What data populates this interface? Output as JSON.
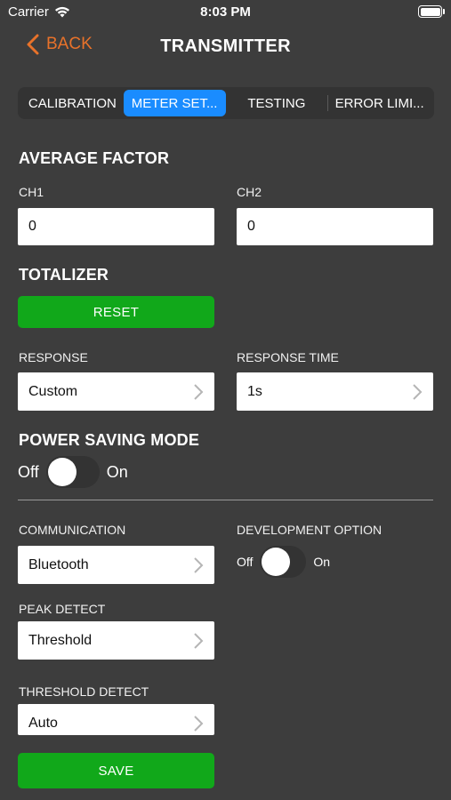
{
  "status": {
    "carrier": "Carrier",
    "time": "8:03 PM"
  },
  "nav": {
    "back_label": "BACK",
    "title": "TRANSMITTER"
  },
  "tabs": [
    {
      "label": "CALIBRATION",
      "active": false
    },
    {
      "label": "METER SET...",
      "active": true
    },
    {
      "label": "TESTING",
      "active": false
    },
    {
      "label": "ERROR LIMI...",
      "active": false
    }
  ],
  "average_factor": {
    "title": "AVERAGE FACTOR",
    "ch1_label": "CH1",
    "ch1_value": "0",
    "ch2_label": "CH2",
    "ch2_value": "0"
  },
  "totalizer": {
    "title": "TOTALIZER",
    "reset_label": "RESET"
  },
  "response": {
    "label": "RESPONSE",
    "value": "Custom"
  },
  "response_time": {
    "label": "RESPONSE TIME",
    "value": "1s"
  },
  "power_saving": {
    "title": "POWER SAVING MODE",
    "off_label": "Off",
    "on_label": "On",
    "enabled": false
  },
  "communication": {
    "label": "COMMUNICATION",
    "value": "Bluetooth"
  },
  "development_option": {
    "label": "DEVELOPMENT OPTION",
    "off_label": "Off",
    "on_label": "On",
    "enabled": false
  },
  "peak_detect": {
    "label": "PEAK DETECT",
    "value": "Threshold"
  },
  "threshold_detect": {
    "label": "THRESHOLD DETECT",
    "value": "Auto"
  },
  "save_label": "SAVE",
  "colors": {
    "background": "#3d3d3d",
    "accent_orange": "#e8722a",
    "active_tab": "#1a8cff",
    "button_green": "#11a81a"
  }
}
